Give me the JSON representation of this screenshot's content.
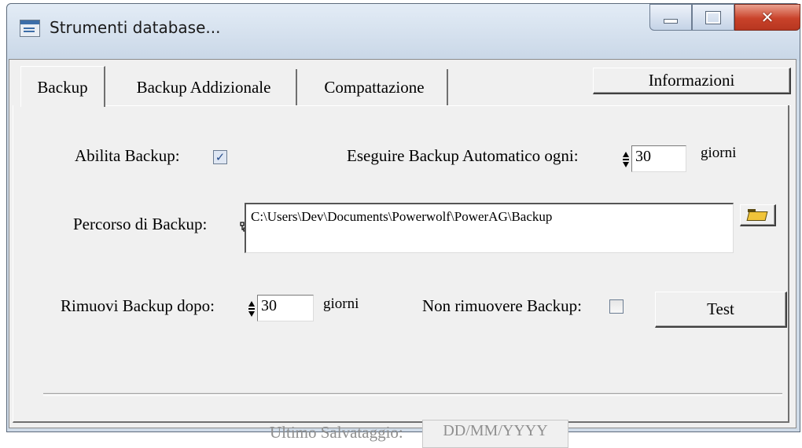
{
  "window": {
    "title": "Strumenti database..."
  },
  "tabs": [
    "Backup",
    "Backup Addizionale",
    "Compattazione"
  ],
  "buttons": {
    "info": "Informazioni",
    "test": "Test"
  },
  "backup": {
    "enable_label": "Abilita Backup:",
    "enable_checked": true,
    "auto_label": "Eseguire Backup Automatico ogni:",
    "auto_days": "30",
    "days_unit": "giorni",
    "path_label": "Percorso di Backup:",
    "path_value": "C:\\Users\\Dev\\Documents\\Powerwolf\\PowerAG\\Backup",
    "remove_label": "Rimuovi Backup dopo:",
    "remove_days": "30",
    "no_remove_label": "Non rimuovere Backup:",
    "no_remove_checked": false,
    "last_label": "Ultimo Salvataggio:",
    "last_value": "DD/MM/YYYY"
  },
  "icons": {
    "app": "database-tools-icon",
    "browse": "folder-open-icon",
    "path_marker": "tree-node-icon"
  },
  "colors": {
    "check": "#2a4f8c",
    "close_button": "#c9422a"
  }
}
